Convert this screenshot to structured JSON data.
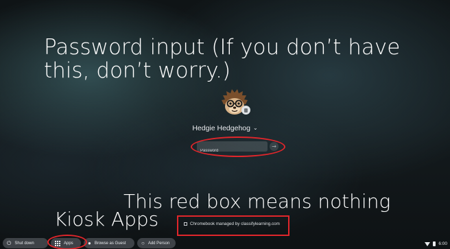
{
  "annotations": {
    "password_note": "Password input (If you don’t have this, don’t worry.)",
    "red_box_note": "This red box means nothing",
    "kiosk_note": "Kiosk Apps"
  },
  "user": {
    "name": "Hedgie Hedgehog",
    "avatar_icon": "hedgehog-avatar-icon",
    "badge_icon": "managed-building-icon"
  },
  "password": {
    "placeholder": "Password",
    "submit_icon": "arrow-right-icon"
  },
  "managed": {
    "text": "Chromebook managed by classifylearning.com",
    "icon": "building-icon"
  },
  "shelf": {
    "shutdown_label": "Shut down",
    "apps_label": "Apps",
    "guest_label": "Browse as Guest",
    "add_person_label": "Add Person"
  },
  "status": {
    "time": "6:00"
  },
  "colors": {
    "annotation_red": "#e0262b",
    "shelf_pill": "#464b50",
    "text": "#e8eaed"
  }
}
